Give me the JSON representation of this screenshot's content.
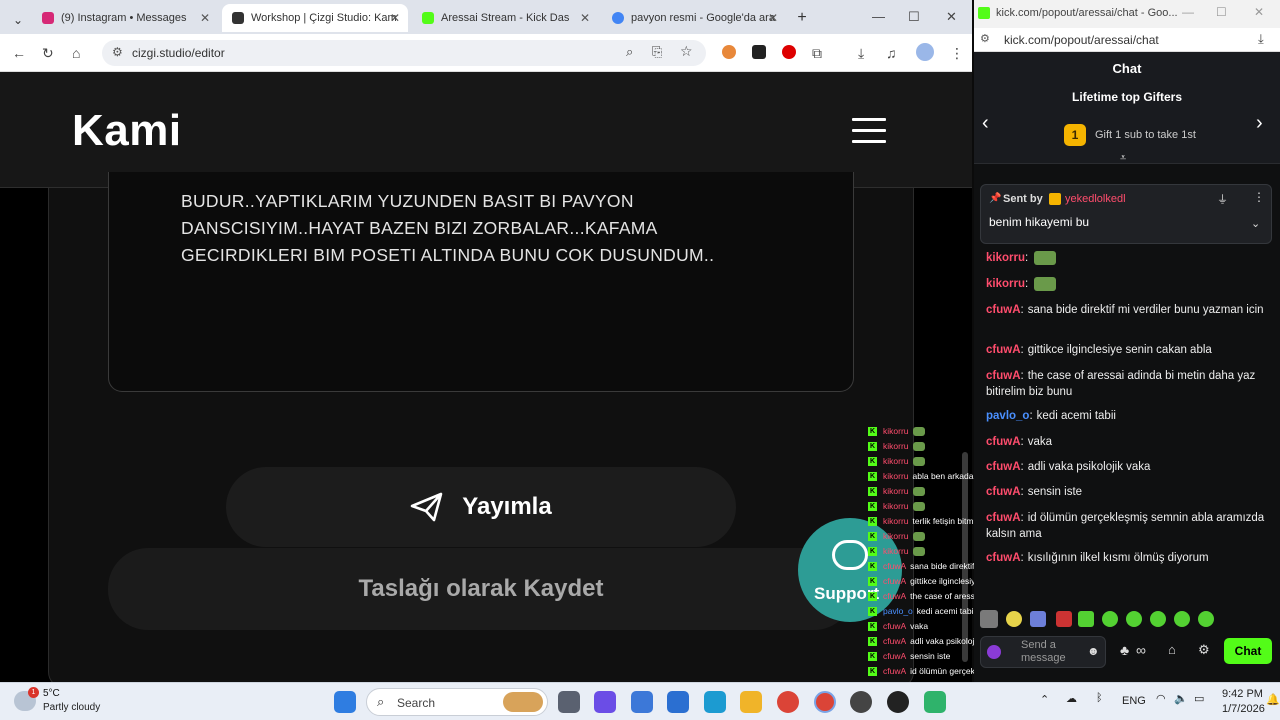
{
  "browser": {
    "tabs": [
      {
        "title": "(9) Instagram • Messages",
        "favicon_color": "#d62976"
      },
      {
        "title": "Workshop | Çizgi Studio: Kam",
        "favicon_color": "#333333"
      },
      {
        "title": "Aressai Stream - Kick Das",
        "favicon_color": "#53fc18"
      },
      {
        "title": "pavyon resmi - Google'da ara",
        "favicon_color": "#4285f4"
      }
    ],
    "new_tab": "+",
    "url": "cizgi.studio/editor"
  },
  "site": {
    "logo": "Kami",
    "story_text": "BUDUR..YAPTIKLARIM YUZUNDEN BASIT BI PAVYON DANSCISIYIM..HAYAT BAZEN BIZI ZORBALAR...KAFAMA GECIRDIKLERI BIM POSETI ALTINDA BUNU COK DUSUNDUM..",
    "publish_label": "Yayımla",
    "draft_label": "Taslağı olarak Kaydet",
    "support_label": "Support"
  },
  "overlay_chat": [
    {
      "user": "kikorru",
      "text": "",
      "color": "#ff4d6d"
    },
    {
      "user": "kikorru",
      "text": "",
      "color": "#ff4d6d"
    },
    {
      "user": "kikorru",
      "text": "",
      "color": "#ff4d6d"
    },
    {
      "user": "kikorru",
      "text": "abla ben arkada video izleyecem arada bakanm",
      "color": "#ff4d6d"
    },
    {
      "user": "kikorru",
      "text": "",
      "color": "#ff4d6d"
    },
    {
      "user": "kikorru",
      "text": "",
      "color": "#ff4d6d"
    },
    {
      "user": "kikorru",
      "text": "terlik fetişin bitmiyo abla",
      "color": "#ff4d6d"
    },
    {
      "user": "kikorru",
      "text": "",
      "color": "#ff4d6d"
    },
    {
      "user": "kikorru",
      "text": "",
      "color": "#ff4d6d"
    },
    {
      "user": "cfuwA",
      "text": "sana bide direktif mi verdiler bunu yazman icin",
      "color": "#ff4d6d"
    },
    {
      "user": "cfuwA",
      "text": "gittikce ilginclesiye senin cakan abla",
      "color": "#ff4d6d"
    },
    {
      "user": "cfuwA",
      "text": "the case of aressai adinda bi metin daha yaz bitirelim biz bunu",
      "color": "#ff4d6d"
    },
    {
      "user": "pavlo_o",
      "text": "kedi acemi tabii",
      "color": "#4a90ff"
    },
    {
      "user": "cfuwA",
      "text": "vaka",
      "color": "#ff4d6d"
    },
    {
      "user": "cfuwA",
      "text": "adli vaka psikolojik vaka",
      "color": "#ff4d6d"
    },
    {
      "user": "cfuwA",
      "text": "sensin iste",
      "color": "#ff4d6d"
    },
    {
      "user": "cfuwA",
      "text": "id ölümün gerçekleşmiş semnin abla aramızda kalsın ama",
      "color": "#ff4d6d"
    },
    {
      "user": "cfuwA",
      "text": "kısılığının ilkel kısmı ölmüş diyorum",
      "color": "#ff4d6d"
    },
    {
      "user": "cfuwA",
      "text": "",
      "color": "#ff4d6d"
    }
  ],
  "popout": {
    "url": "kick.com/popout/aressai/chat",
    "window_title": "kick.com/popout/aressai/chat - Goo...",
    "header": "Chat",
    "gifters_title": "Lifetime top Gifters",
    "gift_rank": "1",
    "gift_text": "Gift 1 sub to take 1st",
    "pinned_sent_by": "Sent by",
    "pinned_user": "yekedlolkedl",
    "pinned_text": "benim hikayemi bu",
    "messages": [
      {
        "user": "kikorru",
        "sep": ":",
        "text": "",
        "color": "#ff4d6d"
      },
      {
        "user": "kikorru",
        "sep": ":",
        "text": "",
        "color": "#ff4d6d"
      },
      {
        "user": "cfuwA",
        "sep": ":",
        "text": "sana bide direktif mi verdiler bunu yazman icin",
        "color": "#ff4d6d"
      },
      {
        "user": "cfuwA",
        "sep": ":",
        "text": "gittikce ilginclesiye senin cakan abla",
        "color": "#ff4d6d"
      },
      {
        "user": "cfuwA",
        "sep": ":",
        "text": "the case of aressai adinda bi metin daha yaz bitirelim biz bunu",
        "color": "#ff4d6d"
      },
      {
        "user": "pavlo_o",
        "sep": ":",
        "text": "kedi acemi tabii",
        "color": "#4a90ff"
      },
      {
        "user": "cfuwA",
        "sep": ":",
        "text": "vaka",
        "color": "#ff4d6d"
      },
      {
        "user": "cfuwA",
        "sep": ":",
        "text": "adli vaka psikolojik vaka",
        "color": "#ff4d6d"
      },
      {
        "user": "cfuwA",
        "sep": ":",
        "text": "sensin iste",
        "color": "#ff4d6d"
      },
      {
        "user": "cfuwA",
        "sep": ":",
        "text": "id ölümün gerçekleşmiş semnin abla aramızda kalsın ama",
        "color": "#ff4d6d"
      },
      {
        "user": "cfuwA",
        "sep": ":",
        "text": "kısılığının ilkel kısmı ölmüş diyorum",
        "color": "#ff4d6d"
      }
    ],
    "input_placeholder": "Send a message",
    "chat_button": "Chat"
  },
  "taskbar": {
    "weather_temp": "5°C",
    "weather_desc": "Partly cloudy",
    "weather_badge": "1",
    "search_placeholder": "Search",
    "lang": "ENG",
    "time": "9:42 PM",
    "date": "1/7/2026"
  },
  "colors": {
    "kick_green": "#53fc18",
    "support_teal": "#2d9c95",
    "chat_bg": "#0f1011"
  }
}
